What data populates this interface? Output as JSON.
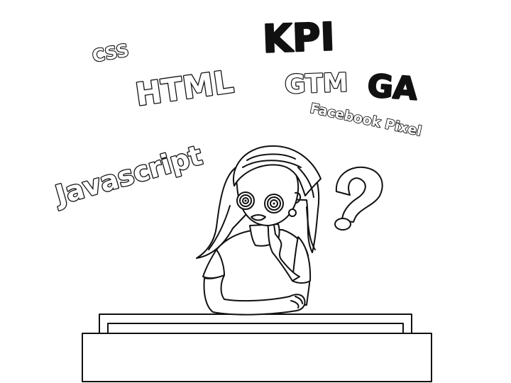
{
  "scene": {
    "words": {
      "css": "CSS",
      "html": "HTML",
      "kpi": "KPI",
      "gtm": "GTM",
      "ga": "GA",
      "facebook_pixel": "Facebook Pixel",
      "javascript": "Javascript"
    },
    "colors": {
      "ink": "#111111",
      "paper": "#ffffff"
    },
    "icons": {
      "question_mark": "question-mark-icon",
      "dizzy_eyes": "spiral-eyes-icon"
    }
  }
}
